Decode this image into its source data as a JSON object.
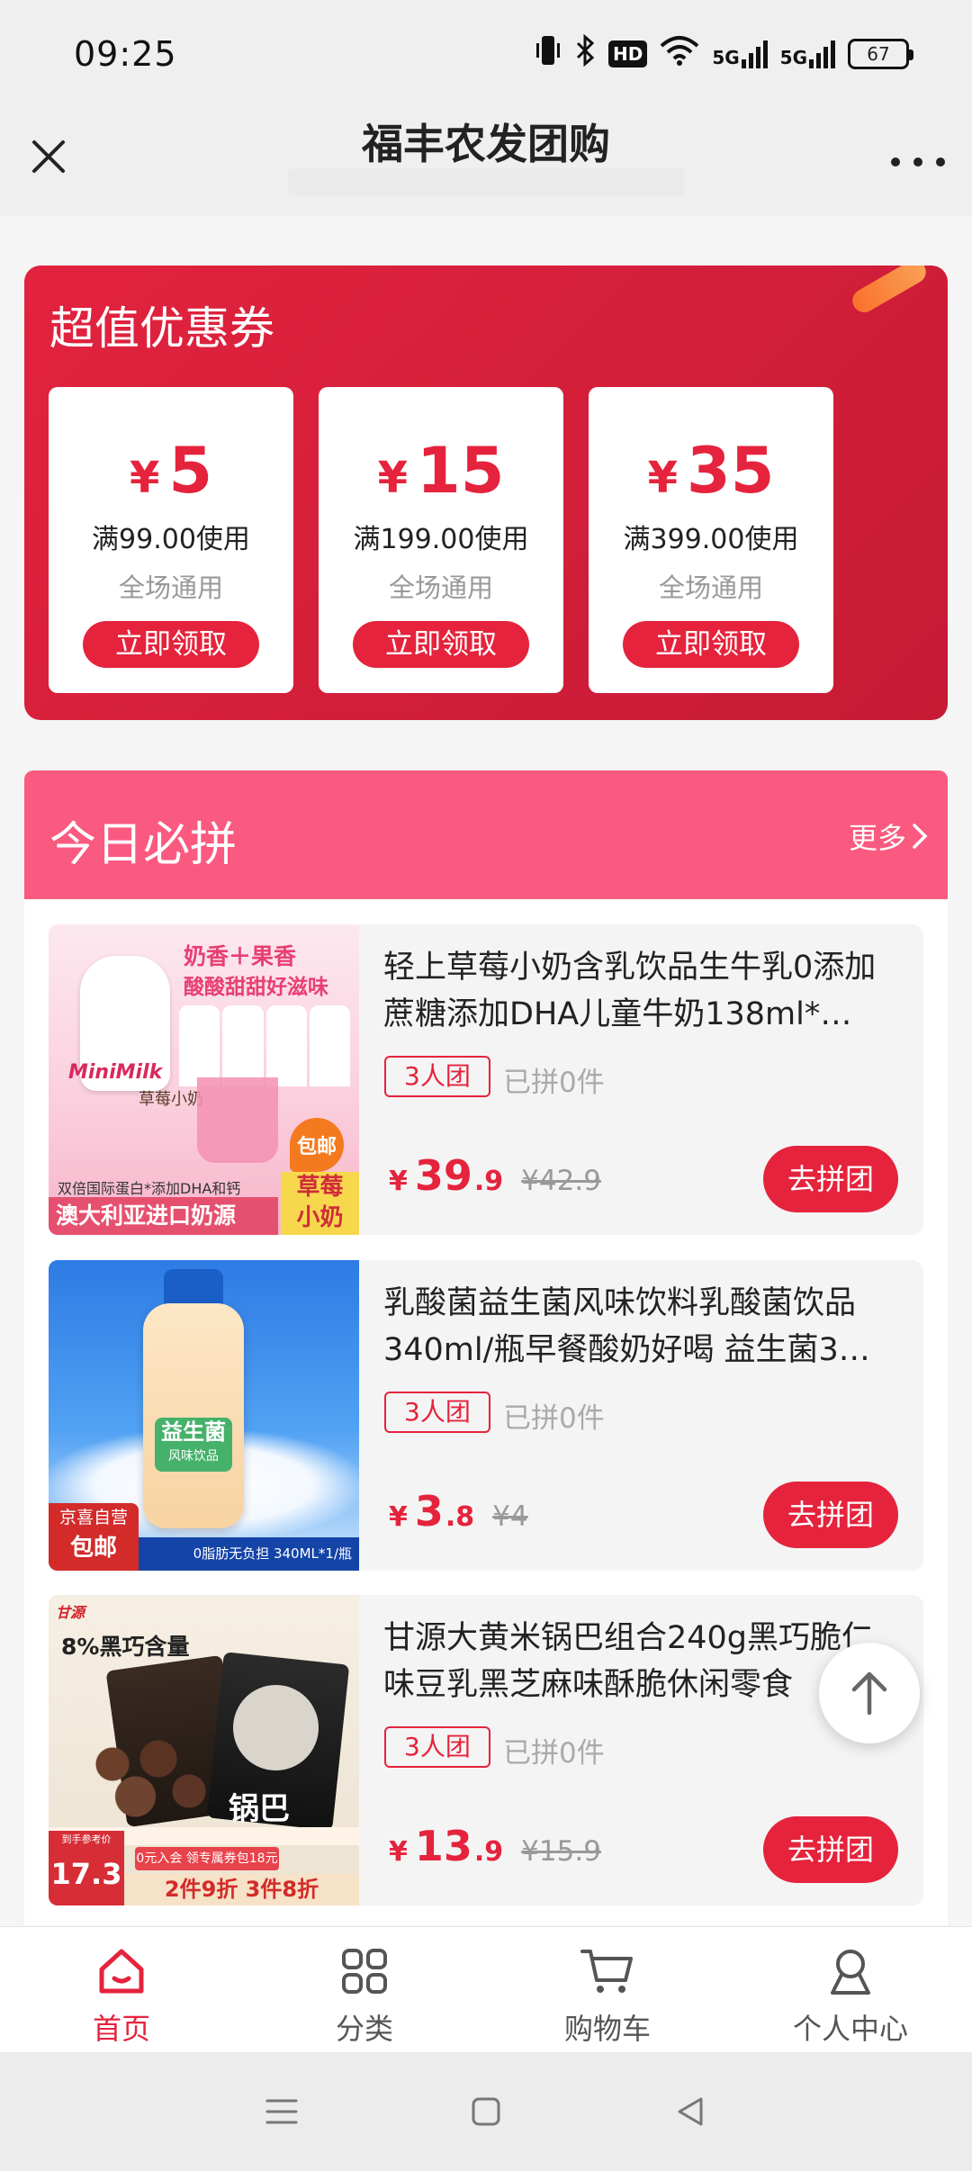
{
  "status_bar": {
    "time": "09:25",
    "hd": "HD",
    "net1": "5G",
    "net2": "5G",
    "battery": "67"
  },
  "header": {
    "title": "福丰农发团购"
  },
  "coupons": {
    "title": "超值优惠券",
    "currency": "¥",
    "items": [
      {
        "amount": "5",
        "condition": "满99.00使用",
        "scope": "全场通用",
        "button": "立即领取"
      },
      {
        "amount": "15",
        "condition": "满199.00使用",
        "scope": "全场通用",
        "button": "立即领取"
      },
      {
        "amount": "35",
        "condition": "满399.00使用",
        "scope": "全场通用",
        "button": "立即领取"
      }
    ]
  },
  "group_buy": {
    "title": "今日必拼",
    "more": "更多",
    "currency": "¥",
    "products": [
      {
        "name": "轻上草莓小奶含乳饮品生牛乳0添加蔗糖添加DHA儿童牛奶138ml*…",
        "tag": "3人团",
        "sold": "已拼0件",
        "price_int": "39",
        "price_dec": ".9",
        "orig": "¥42.9",
        "button": "去拼团",
        "thumb_text": {
          "top": "奶香＋果香",
          "top2": "酸酸甜甜好滋味",
          "brand": "MiniMilk",
          "sub": "草莓小奶",
          "mid": "双倍国际蛋白*添加DHA和钙",
          "badge": "包邮",
          "bottom": "澳大利亚进口奶源",
          "side1": "草莓",
          "side2": "小奶"
        }
      },
      {
        "name": "乳酸菌益生菌风味饮料乳酸菌饮品340ml/瓶早餐酸奶好喝 益生菌3…",
        "tag": "3人团",
        "sold": "已拼0件",
        "price_int": "3",
        "price_dec": ".8",
        "orig": "¥4",
        "button": "去拼团",
        "thumb_text": {
          "bottle": "益生菌",
          "bottle2": "风味饮品",
          "badge1": "京喜自营",
          "badge2": "包邮",
          "strip": "0脂肪无负担 340ML*1/瓶"
        }
      },
      {
        "name": "甘源大黄米锅巴组合240g黑巧脆仁味豆乳黑芝麻味酥脆休闲零食",
        "tag": "3人团",
        "sold": "已拼0件",
        "price_int": "13",
        "price_dec": ".9",
        "orig": "¥15.9",
        "button": "去拼团",
        "thumb_text": {
          "brand": "甘源",
          "top": "8%黑巧含量",
          "price": "17.3",
          "price_label": "到手参考价",
          "promo": "0元入会 领专属券包18元",
          "deal": "2件9折 3件8折",
          "pack": "锅巴"
        }
      }
    ]
  },
  "bottom_nav": [
    {
      "label": "首页",
      "icon": "home-icon",
      "active": true
    },
    {
      "label": "分类",
      "icon": "category-icon",
      "active": false
    },
    {
      "label": "购物车",
      "icon": "cart-icon",
      "active": false
    },
    {
      "label": "个人中心",
      "icon": "user-icon",
      "active": false
    }
  ],
  "colors": {
    "primary": "#e5233c",
    "pink_header": "#fa5a7f"
  }
}
